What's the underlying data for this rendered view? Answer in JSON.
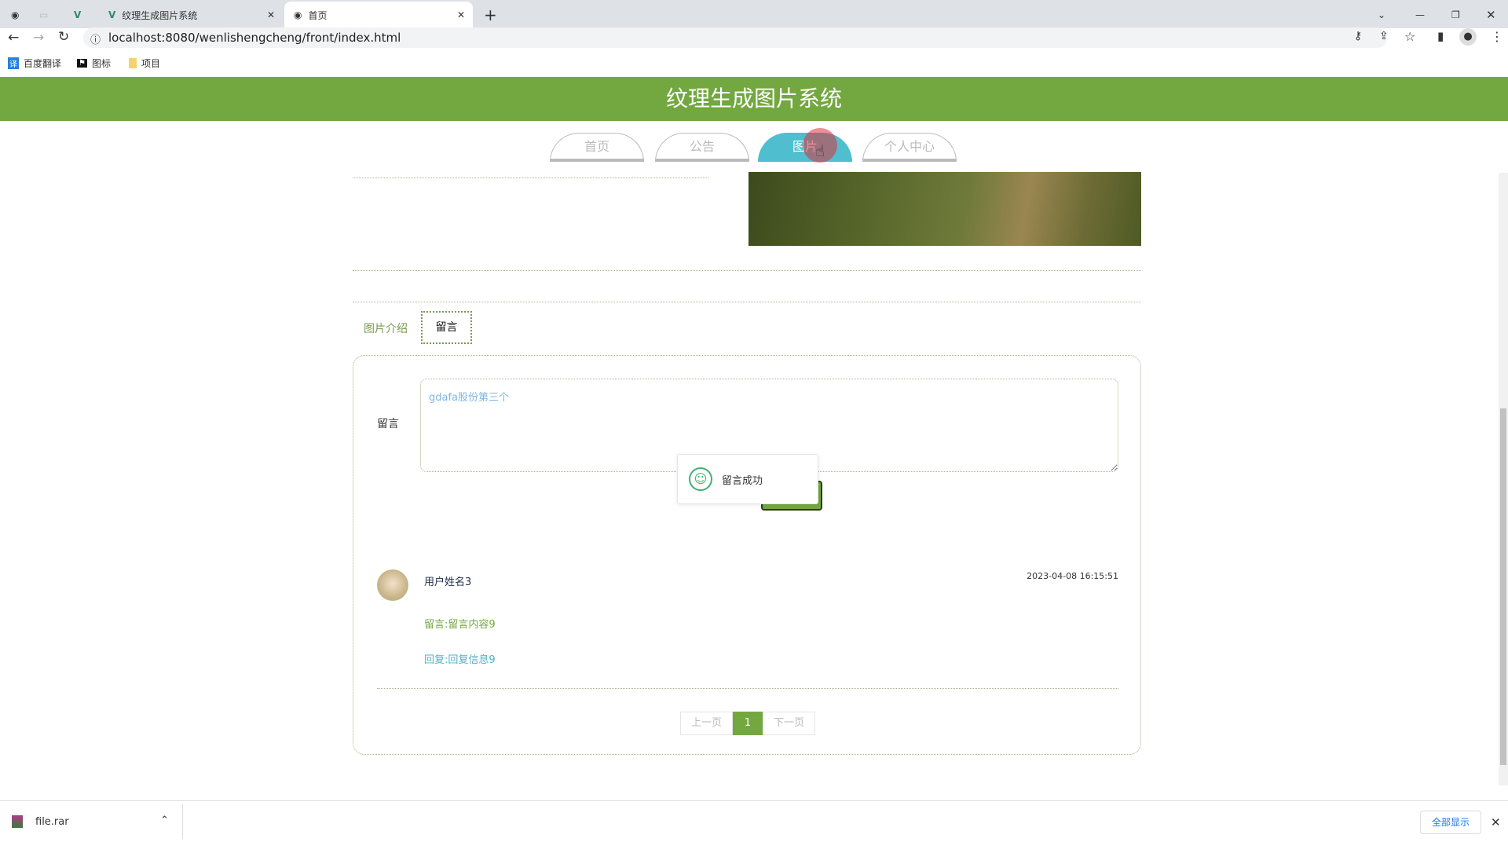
{
  "browser": {
    "tabs": [
      {
        "title": "纹理生成图片系统"
      },
      {
        "title": "首页"
      }
    ],
    "url": "localhost:8080/wenlishengcheng/front/index.html",
    "bookmarks": [
      "百度翻译",
      "图标",
      "项目"
    ]
  },
  "header": {
    "title": "纹理生成图片系统"
  },
  "nav": {
    "items": [
      "首页",
      "公告",
      "图片",
      "个人中心"
    ],
    "active": "图片"
  },
  "detail_tabs": {
    "items": [
      "图片介绍",
      "留言"
    ],
    "active": "留言"
  },
  "form": {
    "label": "留言",
    "value": "gdafa股份第三个"
  },
  "toast": {
    "message": "留言成功"
  },
  "comments": [
    {
      "user": "用户姓名3",
      "time": "2023-04-08 16:15:51",
      "content": "留言:留言内容9",
      "reply": "回复:回复信息9"
    }
  ],
  "pagination": {
    "prev": "上一页",
    "current": "1",
    "next": "下一页"
  },
  "download": {
    "file": "file.rar",
    "show_all": "全部显示"
  },
  "colors": {
    "brand": "#72a83f",
    "nav_active": "#4fbfcf"
  }
}
